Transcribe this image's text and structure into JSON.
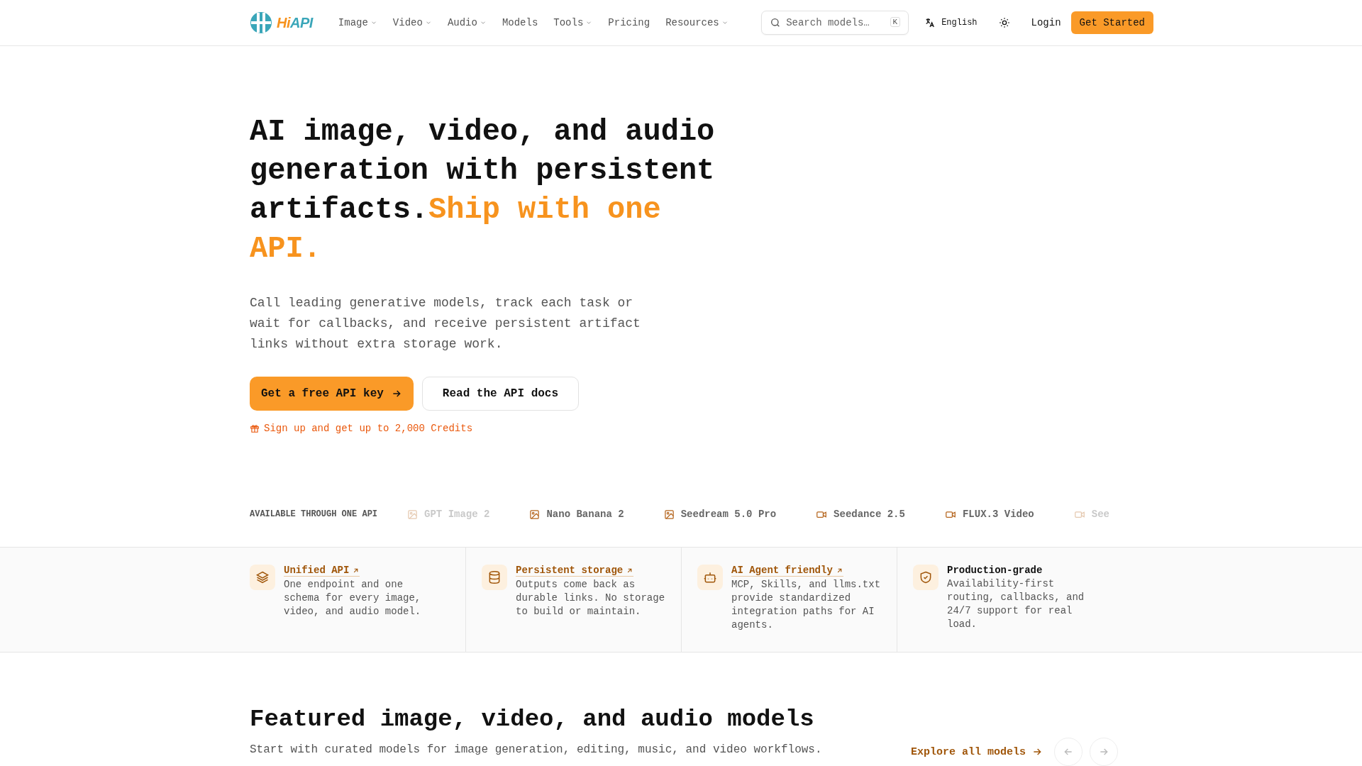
{
  "nav": {
    "logo": "HiAPI",
    "menu": [
      {
        "label": "Image",
        "dropdown": true
      },
      {
        "label": "Video",
        "dropdown": true
      },
      {
        "label": "Audio",
        "dropdown": true
      },
      {
        "label": "Models",
        "dropdown": false
      },
      {
        "label": "Tools",
        "dropdown": true
      },
      {
        "label": "Pricing",
        "dropdown": false
      },
      {
        "label": "Resources",
        "dropdown": true
      }
    ],
    "search": {
      "placeholder": "Search models…",
      "shortcut": "K"
    },
    "language": "English",
    "login": "Login",
    "cta": "Get Started"
  },
  "hero": {
    "title": "AI image, video, and audio generation with persistent artifacts.",
    "highlight": "Ship with one API.",
    "description": "Call leading generative models, track each task or wait for callbacks, and receive persistent artifact links without extra storage work.",
    "primary_button": "Get a free API key",
    "secondary_button": "Read the API docs",
    "promo": "Sign up and get up to 2,000 Credits"
  },
  "models_strip": {
    "label": "AVAILABLE THROUGH ONE API",
    "items": [
      {
        "name": "GPT Image 2",
        "kind": "image",
        "faded": true
      },
      {
        "name": "Nano Banana 2",
        "kind": "image",
        "faded": false
      },
      {
        "name": "Seedream 5.0 Pro",
        "kind": "image",
        "faded": false
      },
      {
        "name": "Seedance 2.5",
        "kind": "video",
        "faded": false
      },
      {
        "name": "FLUX.3 Video",
        "kind": "video",
        "faded": false
      },
      {
        "name": "See",
        "kind": "video",
        "faded": true
      }
    ]
  },
  "features": [
    {
      "title": "Unified API",
      "link": true,
      "text": "One endpoint and one schema for every image, video, and audio model."
    },
    {
      "title": "Persistent storage",
      "link": true,
      "text": "Outputs come back as durable links. No storage to build or maintain."
    },
    {
      "title": "AI Agent friendly",
      "link": true,
      "text": "MCP, Skills, and llms.txt provide standardized integration paths for AI agents."
    },
    {
      "title": "Production-grade",
      "link": false,
      "text": "Availability-first routing, callbacks, and 24/7 support for real load."
    }
  ],
  "featured": {
    "title": "Featured image, video, and audio models",
    "subtitle": "Start with curated models for image generation, editing, music, and video workflows.",
    "explore": "Explore all models"
  }
}
